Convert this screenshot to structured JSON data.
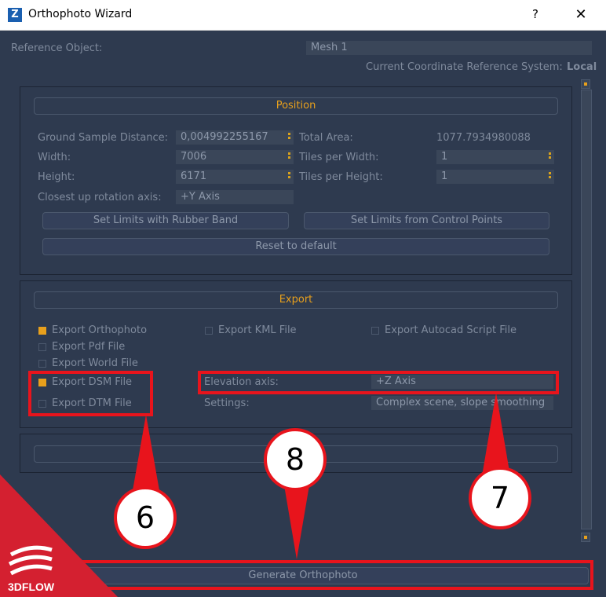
{
  "window": {
    "title": "Orthophoto Wizard",
    "app_icon": "Z",
    "help": "?",
    "close": "✕"
  },
  "reference": {
    "label": "Reference Object:",
    "value": "Mesh 1"
  },
  "crs": {
    "label": "Current Coordinate Reference System:",
    "value": "Local"
  },
  "position": {
    "title": "Position",
    "gsd_label": "Ground Sample Distance:",
    "gsd_value": "0,004992255167",
    "width_label": "Width:",
    "width_value": "7006",
    "height_label": "Height:",
    "height_value": "6171",
    "rotation_label": "Closest up rotation axis:",
    "rotation_value": "+Y Axis",
    "total_area_label": "Total Area:",
    "total_area_value": "1077.7934980088",
    "tiles_w_label": "Tiles per Width:",
    "tiles_w_value": "1",
    "tiles_h_label": "Tiles per Height:",
    "tiles_h_value": "1",
    "rubber_band_btn": "Set Limits with Rubber Band",
    "control_points_btn": "Set Limits from Control Points",
    "reset_btn": "Reset to default"
  },
  "export": {
    "title": "Export",
    "orthophoto": "Export Orthophoto",
    "pdf": "Export Pdf File",
    "world": "Export World File",
    "dsm": "Export DSM File",
    "dtm": "Export DTM File",
    "kml": "Export KML File",
    "autocad": "Export Autocad Script File",
    "elevation_label": "Elevation axis:",
    "elevation_value": "+Z Axis",
    "settings_label": "Settings:",
    "settings_value": "Complex scene, slope smoothing",
    "checked": {
      "orthophoto": true,
      "pdf": false,
      "world": false,
      "dsm": true,
      "dtm": false,
      "kml": false,
      "autocad": false
    }
  },
  "generate_btn": "Generate Orthophoto",
  "callouts": {
    "six": "6",
    "seven": "7",
    "eight": "8"
  },
  "brand": {
    "logo_text": "3DFLOW"
  },
  "colors": {
    "accent": "#e8a01c",
    "highlight": "#e8141c",
    "background": "#2e3a4f"
  }
}
